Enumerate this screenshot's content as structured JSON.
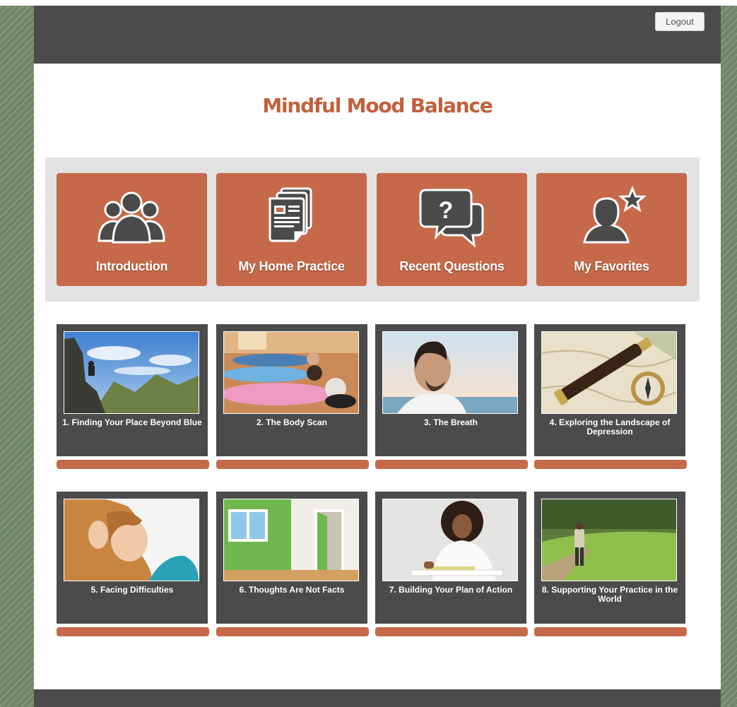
{
  "header": {
    "logout_label": "Logout"
  },
  "app_title": "Mindful Mood Balance",
  "nav": [
    {
      "label": "Introduction",
      "icon": "people-group-icon"
    },
    {
      "label": "My Home Practice",
      "icon": "document-icon"
    },
    {
      "label": "Recent Questions",
      "icon": "question-bubbles-icon"
    },
    {
      "label": "My Favorites",
      "icon": "person-star-icon"
    }
  ],
  "sessions": [
    {
      "label": "1. Finding Your Place Beyond Blue",
      "image": "hiker-on-mountain-photo"
    },
    {
      "label": "2. The Body Scan",
      "image": "people-lying-down-photo"
    },
    {
      "label": "3. The Breath",
      "image": "man-breathing-photo"
    },
    {
      "label": "4. Exploring the Landscape of Depression",
      "image": "telescope-compass-map-photo"
    },
    {
      "label": "5. Facing Difficulties",
      "image": "tired-woman-photo"
    },
    {
      "label": "6. Thoughts Are Not Facts",
      "image": "green-room-door-photo"
    },
    {
      "label": "7. Building Your Plan of Action",
      "image": "woman-writing-photo"
    },
    {
      "label": "8. Supporting Your Practice in the World",
      "image": "woman-walking-path-photo"
    }
  ],
  "colors": {
    "accent": "#c6694a",
    "title": "#c1603c",
    "header": "#4b4b4b",
    "panel": "#e3e3e3"
  }
}
